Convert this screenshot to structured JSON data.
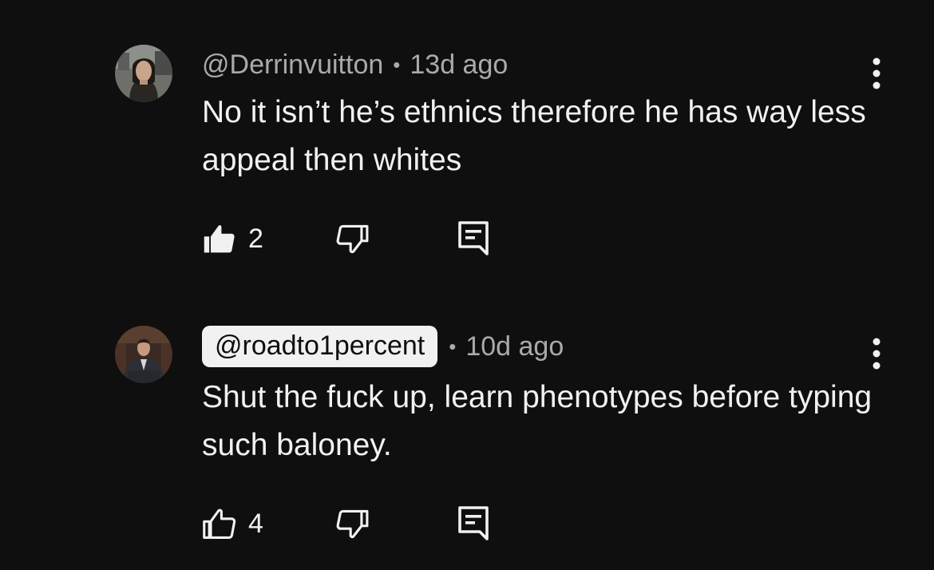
{
  "comments": [
    {
      "handle": "@Derrinvuitton",
      "separator": "•",
      "time": "13d ago",
      "text": "No it isn’t he’s ethnics therefore he has way less appeal then whites",
      "likes": "2",
      "liked": true,
      "avatar_icon": "profile-photo-icon"
    },
    {
      "handle": "@roadto1percent",
      "separator": "•",
      "time": "10d ago",
      "text": "Shut the fuck up, learn phenotypes before typing such baloney.",
      "likes": "4",
      "liked": false,
      "highlighted_handle": true,
      "avatar_icon": "profile-photo-icon"
    }
  ],
  "icons": {
    "like": "thumbs-up-icon",
    "dislike": "thumbs-down-icon",
    "reply": "reply-comment-icon",
    "menu": "more-vertical-icon"
  },
  "colors": {
    "background": "#0f0f0f",
    "text_primary": "#f1f1f1",
    "text_secondary": "#aaaaaa",
    "handle_pill_bg": "#f1f1f1",
    "handle_pill_text": "#0f0f0f"
  }
}
